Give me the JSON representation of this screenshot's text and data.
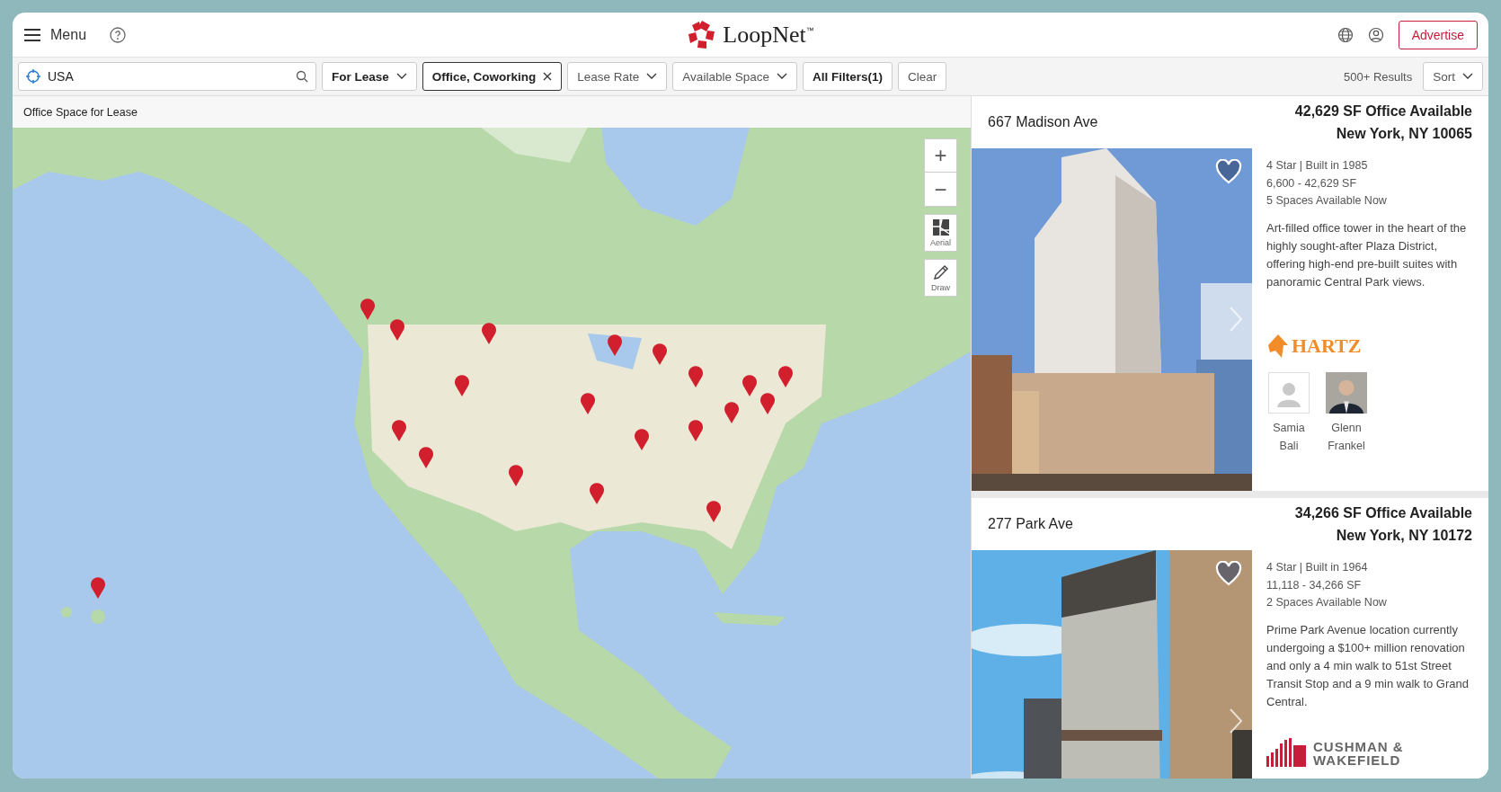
{
  "header": {
    "menu_label": "Menu",
    "logo_name": "LoopNet",
    "logo_mark": "™",
    "advertise": "Advertise"
  },
  "search": {
    "value": "USA"
  },
  "filters": [
    {
      "label": "For Lease",
      "kind": "dropdown",
      "active": true
    },
    {
      "label": "Office, Coworking",
      "kind": "removable",
      "active": true
    },
    {
      "label": "Lease Rate",
      "kind": "dropdown",
      "active": false
    },
    {
      "label": "Available Space",
      "kind": "dropdown",
      "active": false
    },
    {
      "label": "All Filters(1)",
      "kind": "button",
      "active": true
    },
    {
      "label": "Clear",
      "kind": "button",
      "active": false
    }
  ],
  "results_count": "500+ Results",
  "sort": "Sort",
  "map": {
    "heading": "Office Space for Lease",
    "zoom_in": "+",
    "zoom_out": "−",
    "aerial": "Aerial",
    "draw": "Draw"
  },
  "listings": [
    {
      "address": "667 Madison Ave",
      "headline": "42,629 SF Office Available",
      "location": "New York, NY 10065",
      "facts": [
        "4 Star | Built in 1985",
        "6,600 - 42,629 SF",
        "5 Spaces Available Now"
      ],
      "description": "Art-filled office tower in the heart of the highly sought-after Plaza District, offering high-end pre-built suites with panoramic Central Park views.",
      "logo": {
        "kind": "hartz",
        "lines": [
          "HARTZ"
        ]
      },
      "brokers": [
        {
          "kind": "placeholder",
          "first": "Samia",
          "last": "Bali"
        },
        {
          "first": "Glenn",
          "last": "Frankel"
        }
      ]
    },
    {
      "address": "277 Park Ave",
      "headline": "34,266 SF Office Available",
      "location": "New York, NY 10172",
      "facts": [
        "4 Star | Built in 1964",
        "11,118 - 34,266 SF",
        "2 Spaces Available Now"
      ],
      "description": "Prime Park Avenue location currently undergoing a $100+ million renovation and only a 4 min walk to 51st Street Transit Stop and a 9 min walk to Grand Central.",
      "logo": {
        "kind": "cushman",
        "lines": [
          "CUSHMAN &",
          "WAKEFIELD"
        ]
      }
    }
  ]
}
